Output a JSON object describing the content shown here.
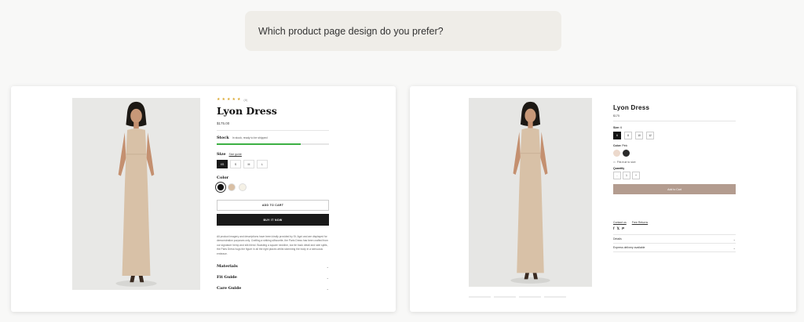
{
  "question": "Which product page design do you prefer?",
  "design_a": {
    "rating_count": "(8)",
    "title": "Lyon Dress",
    "price": "$175.00",
    "stock_label": "Stock",
    "stock_status": "In stock, ready to be shipped",
    "stock_level": 0.75,
    "size_label": "Size",
    "size_guide": "Size guide",
    "sizes": [
      "XS",
      "S",
      "M",
      "L"
    ],
    "color_label": "Color",
    "colors": [
      "#111111",
      "#d9bfa4",
      "#f5f1e6"
    ],
    "add_to_cart": "ADD TO CART",
    "buy_now": "BUY IT NOW",
    "description": "All product imagery and descriptions have been kindly provided by St. Agni and are displayed for demonstration purposes only. Crafting a striking silhouette, the Paris Dress has been crafted from our signature hemp and silk blend. Boasting a square neckline, low tie back detail and side splits, the Paris Dress hugs the figure in all the right places whilst skimming the body in a sensuous embrace.",
    "accordions": [
      "Materials",
      "Fit Guide",
      "Care Guide"
    ]
  },
  "design_b": {
    "title": "Lyon Dress",
    "price": "$175",
    "size_label": "Size:",
    "size_value": "6",
    "sizes": [
      "6",
      "8",
      "10",
      "12"
    ],
    "color_label": "Color:",
    "color_value": "Pink",
    "colors": [
      "#ecd9cc",
      "#2b2b2b"
    ],
    "fit_note": "Fits true to size",
    "quantity_label": "Quantity",
    "quantity_value": "1",
    "qty_minus": "-",
    "qty_plus": "+",
    "add_to_cart": "Add to Cart",
    "links": [
      "Contact us",
      "Free Returns"
    ],
    "social": [
      "f",
      "𝕏",
      "P"
    ],
    "accordions": [
      "Details",
      "Express delivery available"
    ]
  },
  "icons": {
    "accordion": "chevron-down-icon",
    "rating": "star-icon"
  },
  "colors": {
    "accent_green": "#3cb043",
    "cart_b": "#b39c8f",
    "star": "#d9a52a"
  }
}
